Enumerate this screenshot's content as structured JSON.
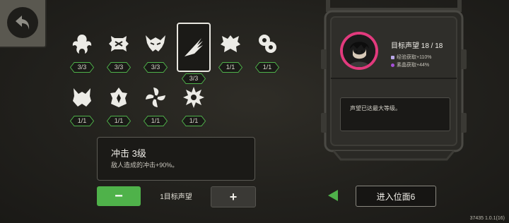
{
  "perks": [
    {
      "name": "perk-icon-1",
      "level": "3/3",
      "selected": false
    },
    {
      "name": "perk-icon-2",
      "level": "3/3",
      "selected": false
    },
    {
      "name": "perk-icon-3",
      "level": "3/3",
      "selected": false
    },
    {
      "name": "perk-icon-4",
      "level": "3/3",
      "selected": true
    },
    {
      "name": "perk-icon-5",
      "level": "1/1",
      "selected": false
    },
    {
      "name": "perk-icon-6",
      "level": "1/1",
      "selected": false
    },
    {
      "name": "perk-icon-7",
      "level": "1/1",
      "selected": false
    },
    {
      "name": "perk-icon-8",
      "level": "1/1",
      "selected": false
    },
    {
      "name": "perk-icon-9",
      "level": "1/1",
      "selected": false
    },
    {
      "name": "perk-icon-10",
      "level": "1/1",
      "selected": false
    }
  ],
  "detail": {
    "title": "冲击 3级",
    "description": "敌人造成的冲击+90%。"
  },
  "controls": {
    "minus": "−",
    "plus": "+",
    "level_label": "1目标声望"
  },
  "reputation": {
    "title": "目标声望 18 / 18",
    "stats": [
      {
        "text": "经验获取+110%",
        "color": "#b9a7e8"
      },
      {
        "text": "素晶获取+44%",
        "color": "#a64fd8"
      }
    ],
    "message": "声望已达最大等级。"
  },
  "enter_button": "进入位面6",
  "version": "37435 1.0.1(16)",
  "colors": {
    "accent_green": "#4fb24a",
    "portrait_ring": "#e13a7d"
  }
}
